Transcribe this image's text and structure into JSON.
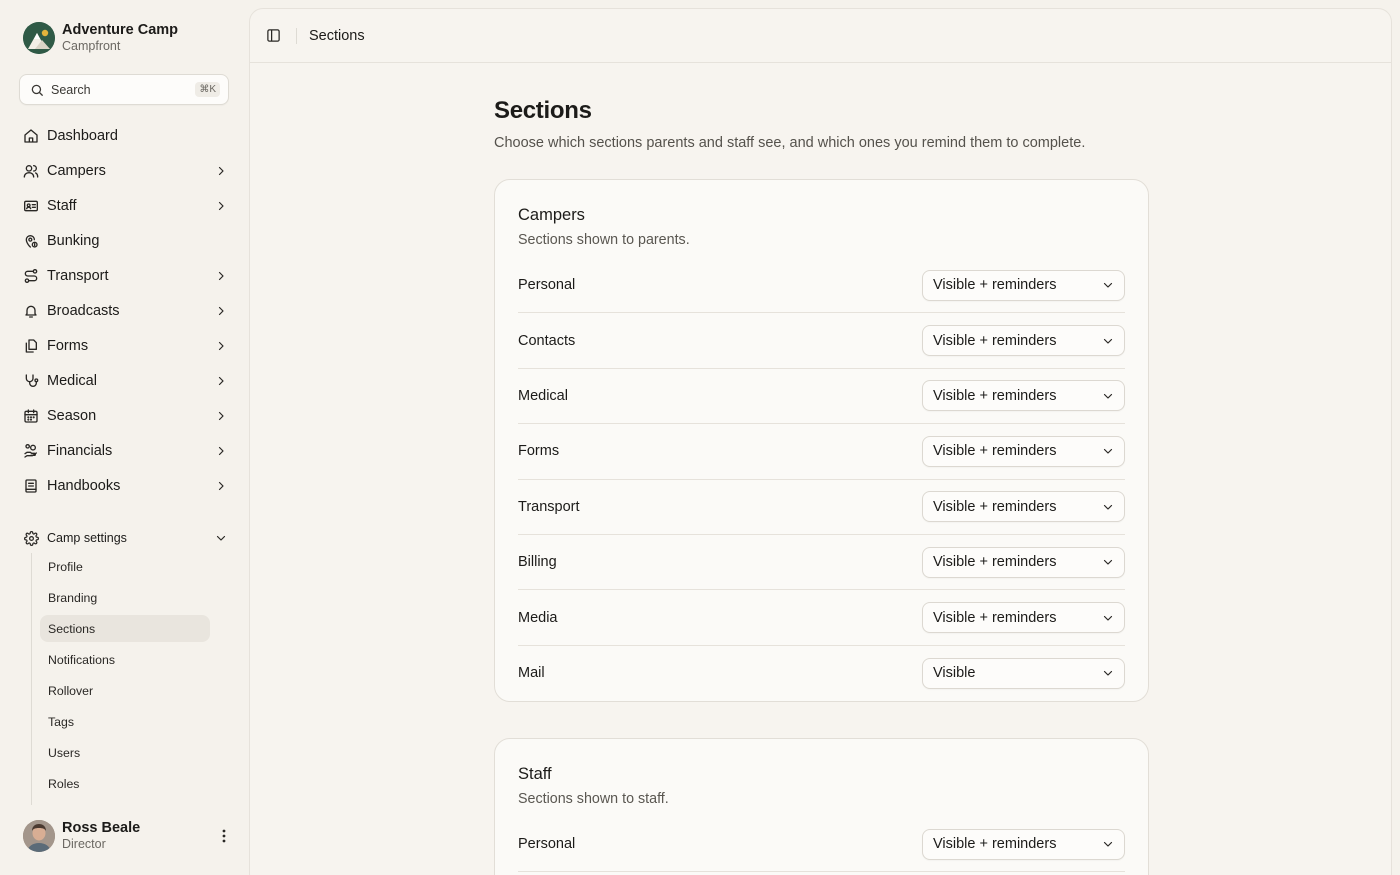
{
  "brand": {
    "name": "Adventure Camp",
    "sub": "Campfront"
  },
  "search": {
    "label": "Search",
    "shortcut": "⌘K"
  },
  "nav": {
    "items": [
      {
        "label": "Dashboard",
        "icon": "home-icon",
        "chevron": false
      },
      {
        "label": "Campers",
        "icon": "users-icon",
        "chevron": true
      },
      {
        "label": "Staff",
        "icon": "id-card-icon",
        "chevron": true
      },
      {
        "label": "Bunking",
        "icon": "map-pin-icon",
        "chevron": false
      },
      {
        "label": "Transport",
        "icon": "route-icon",
        "chevron": true
      },
      {
        "label": "Broadcasts",
        "icon": "bell-icon",
        "chevron": true
      },
      {
        "label": "Forms",
        "icon": "files-icon",
        "chevron": true
      },
      {
        "label": "Medical",
        "icon": "stethoscope-icon",
        "chevron": true
      },
      {
        "label": "Season",
        "icon": "calendar-icon",
        "chevron": true
      },
      {
        "label": "Financials",
        "icon": "hand-coins-icon",
        "chevron": true
      },
      {
        "label": "Handbooks",
        "icon": "book-icon",
        "chevron": true
      }
    ]
  },
  "settings": {
    "label": "Camp settings",
    "items": [
      "Profile",
      "Branding",
      "Sections",
      "Notifications",
      "Rollover",
      "Tags",
      "Users",
      "Roles"
    ],
    "active": "Sections"
  },
  "user": {
    "name": "Ross Beale",
    "role": "Director"
  },
  "topbar": {
    "title": "Sections"
  },
  "page": {
    "title": "Sections",
    "description": "Choose which sections parents and staff see, and which ones you remind them to complete."
  },
  "cards": [
    {
      "title": "Campers",
      "description": "Sections shown to parents.",
      "rows": [
        {
          "label": "Personal",
          "value": "Visible + reminders"
        },
        {
          "label": "Contacts",
          "value": "Visible + reminders"
        },
        {
          "label": "Medical",
          "value": "Visible + reminders"
        },
        {
          "label": "Forms",
          "value": "Visible + reminders"
        },
        {
          "label": "Transport",
          "value": "Visible + reminders"
        },
        {
          "label": "Billing",
          "value": "Visible + reminders"
        },
        {
          "label": "Media",
          "value": "Visible + reminders"
        },
        {
          "label": "Mail",
          "value": "Visible"
        }
      ]
    },
    {
      "title": "Staff",
      "description": "Sections shown to staff.",
      "rows": [
        {
          "label": "Personal",
          "value": "Visible + reminders"
        }
      ]
    }
  ],
  "colors": {
    "background": "#f5f2ec",
    "panel": "#f7f4ef",
    "card": "#fbfaf7",
    "brand": "#2f5a46"
  }
}
